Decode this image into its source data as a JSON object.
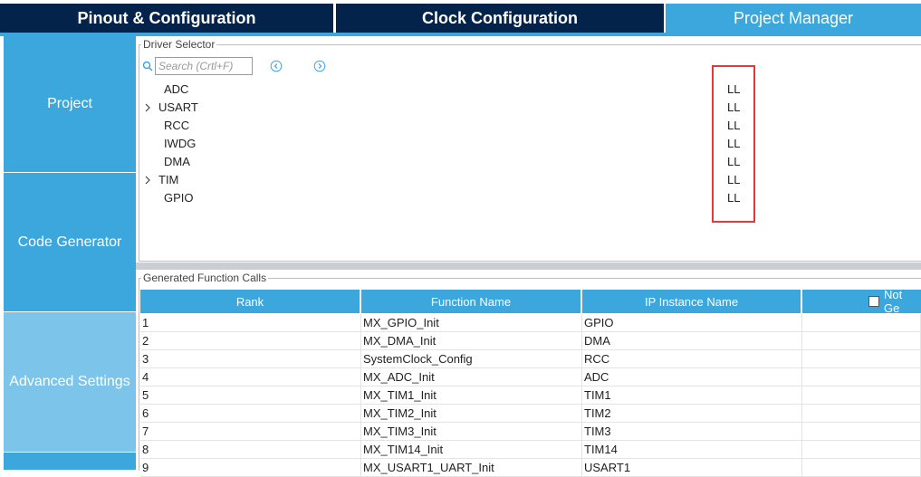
{
  "tabs": [
    {
      "label": "Pinout & Configuration"
    },
    {
      "label": "Clock Configuration"
    },
    {
      "label": "Project Manager"
    }
  ],
  "sidebar": {
    "items": [
      {
        "label": "Project"
      },
      {
        "label": "Code Generator"
      },
      {
        "label": "Advanced Settings"
      }
    ]
  },
  "driver_selector": {
    "title": "Driver Selector",
    "search_placeholder": "Search (Crtl+F)",
    "rows": [
      {
        "name": "ADC",
        "value": "LL",
        "expandable": false
      },
      {
        "name": "USART",
        "value": "LL",
        "expandable": true
      },
      {
        "name": "RCC",
        "value": "LL",
        "expandable": false
      },
      {
        "name": "IWDG",
        "value": "LL",
        "expandable": false
      },
      {
        "name": "DMA",
        "value": "LL",
        "expandable": false
      },
      {
        "name": "TIM",
        "value": "LL",
        "expandable": true
      },
      {
        "name": "GPIO",
        "value": "LL",
        "expandable": false
      }
    ]
  },
  "generated_calls": {
    "title": "Generated Function Calls",
    "columns": [
      "Rank",
      "Function Name",
      "IP Instance Name",
      "Not Ge"
    ],
    "rows": [
      [
        "1",
        "MX_GPIO_Init",
        "GPIO"
      ],
      [
        "2",
        "MX_DMA_Init",
        "DMA"
      ],
      [
        "3",
        "SystemClock_Config",
        "RCC"
      ],
      [
        "4",
        "MX_ADC_Init",
        "ADC"
      ],
      [
        "5",
        "MX_TIM1_Init",
        "TIM1"
      ],
      [
        "6",
        "MX_TIM2_Init",
        "TIM2"
      ],
      [
        "7",
        "MX_TIM3_Init",
        "TIM3"
      ],
      [
        "8",
        "MX_TIM14_Init",
        "TIM14"
      ],
      [
        "9",
        "MX_USART1_UART_Init",
        "USART1"
      ]
    ]
  },
  "colors": {
    "accent": "#3ca7dd",
    "dark_tab": "#03234b",
    "highlight": "#e03a3a"
  }
}
